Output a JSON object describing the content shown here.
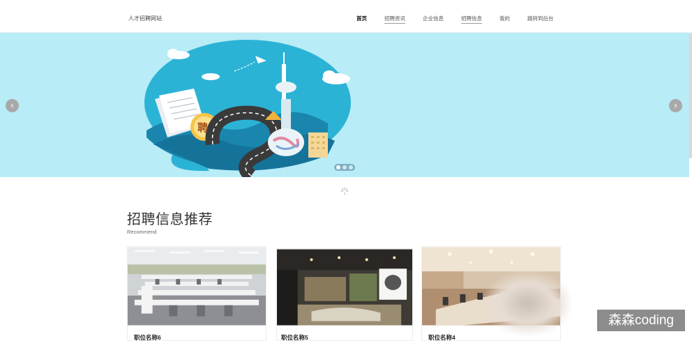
{
  "header": {
    "site_name": "人才招聘网站",
    "nav": [
      {
        "label": "首页",
        "active": true
      },
      {
        "label": "招聘资讯",
        "active": false
      },
      {
        "label": "企业信息",
        "active": false
      },
      {
        "label": "招聘信息",
        "active": false
      },
      {
        "label": "我的",
        "active": false
      },
      {
        "label": "跳转到后台",
        "active": false
      }
    ]
  },
  "banner": {
    "prev_icon": "chevron-left-icon",
    "next_icon": "chevron-right-icon",
    "prev_glyph": "‹",
    "next_glyph": "›",
    "badge_text": "聘",
    "slide_count": 3,
    "active_slide": 1,
    "background_color": "#b8ecf7"
  },
  "loading_icon": "loading-spinner-icon",
  "section": {
    "title": "招聘信息推荐",
    "subtitle": "Recommend"
  },
  "jobs": [
    {
      "title": "职位名称6",
      "image": "open-office-photo"
    },
    {
      "title": "职位名称5",
      "image": "lounge-office-photo"
    },
    {
      "title": "职位名称4",
      "image": "meeting-room-photo"
    }
  ],
  "watermark": "森森coding"
}
